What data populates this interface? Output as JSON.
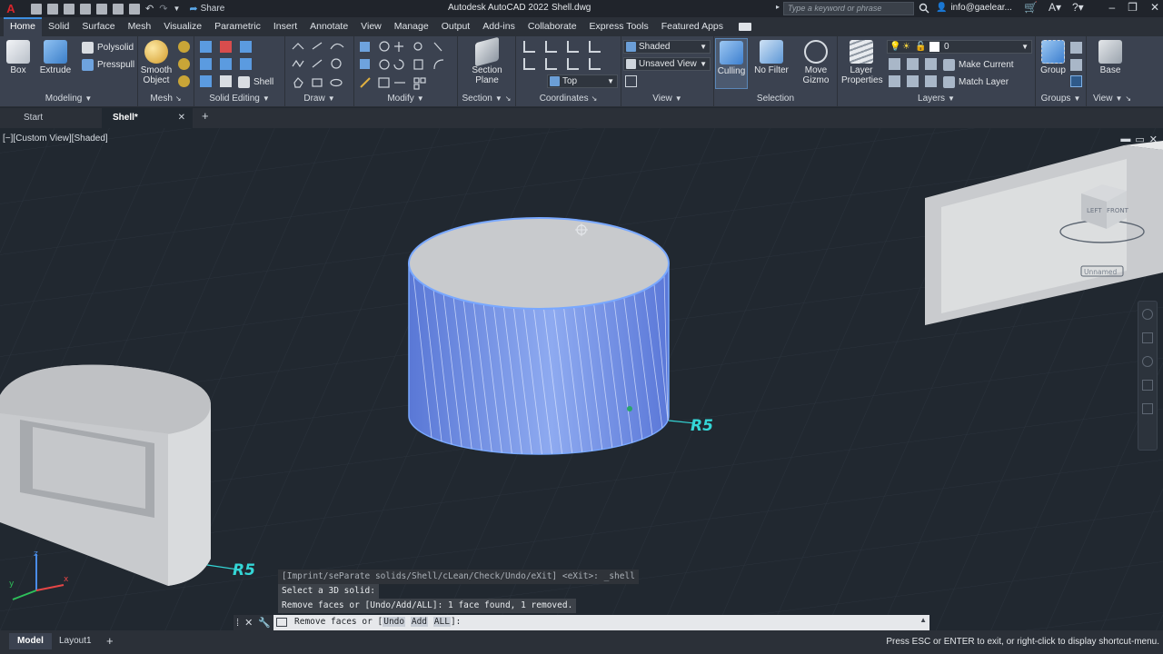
{
  "titlebar": {
    "app_title": "Autodesk AutoCAD 2022",
    "file_name": "Shell.dwg",
    "share_label": "Share",
    "search_placeholder": "Type a keyword or phrase",
    "user": "info@gaelear..."
  },
  "ribbon_tabs": [
    "Home",
    "Solid",
    "Surface",
    "Mesh",
    "Visualize",
    "Parametric",
    "Insert",
    "Annotate",
    "View",
    "Manage",
    "Output",
    "Add-ins",
    "Collaborate",
    "Express Tools",
    "Featured Apps"
  ],
  "active_tab": "Home",
  "panels": {
    "modeling": {
      "title": "Modeling",
      "box": "Box",
      "extrude": "Extrude",
      "polysolid": "Polysolid",
      "presspull": "Presspull"
    },
    "mesh": {
      "title": "Mesh",
      "smooth1": "Smooth",
      "smooth2": "Object"
    },
    "solid_editing": {
      "title": "Solid Editing",
      "shell": "Shell"
    },
    "draw": {
      "title": "Draw"
    },
    "modify": {
      "title": "Modify"
    },
    "section": {
      "title": "Section",
      "plane1": "Section",
      "plane2": "Plane"
    },
    "coordinates": {
      "title": "Coordinates",
      "top": "Top"
    },
    "view": {
      "title": "View",
      "visual_style": "Shaded",
      "named_view": "Unsaved View"
    },
    "selection": {
      "title": "Selection",
      "culling": "Culling",
      "no_filter": "No Filter",
      "gizmo1": "Move",
      "gizmo2": "Gizmo"
    },
    "layers": {
      "title": "Layers",
      "props1": "Layer",
      "props2": "Properties",
      "layer_name": "0",
      "make_current": "Make Current",
      "match_layer": "Match Layer"
    },
    "groups": {
      "title": "Groups",
      "group": "Group"
    },
    "view2": {
      "title": "View",
      "base": "Base"
    }
  },
  "file_tabs": {
    "start": "Start",
    "active": "Shell*"
  },
  "viewport": {
    "view_label": "[−][Custom View][Shaded]",
    "dimension_right": "R5",
    "dimension_left": "R5",
    "viewcube_left": "LEFT",
    "viewcube_front": "FRONT",
    "viewcube_name": "Unnamed"
  },
  "command": {
    "history": [
      "[Imprint/seParate solids/Shell/cLean/Check/Undo/eXit] <eXit>: _shell",
      "Select a 3D solid:",
      "Remove faces or [Undo/Add/ALL]: 1 face found, 1 removed."
    ],
    "prompt_prefix": "Remove faces or [",
    "opt_undo": "Undo",
    "opt_add": "Add",
    "opt_all": "ALL",
    "prompt_suffix": "]:"
  },
  "statusbar": {
    "tabs": [
      "Model",
      "Layout1"
    ],
    "message": "Press ESC or ENTER to exit, or right-click to display shortcut-menu."
  },
  "colors": {
    "accent": "#3d8ee0",
    "cylinder": "#6f93e8",
    "dimension": "#34d6d6"
  }
}
